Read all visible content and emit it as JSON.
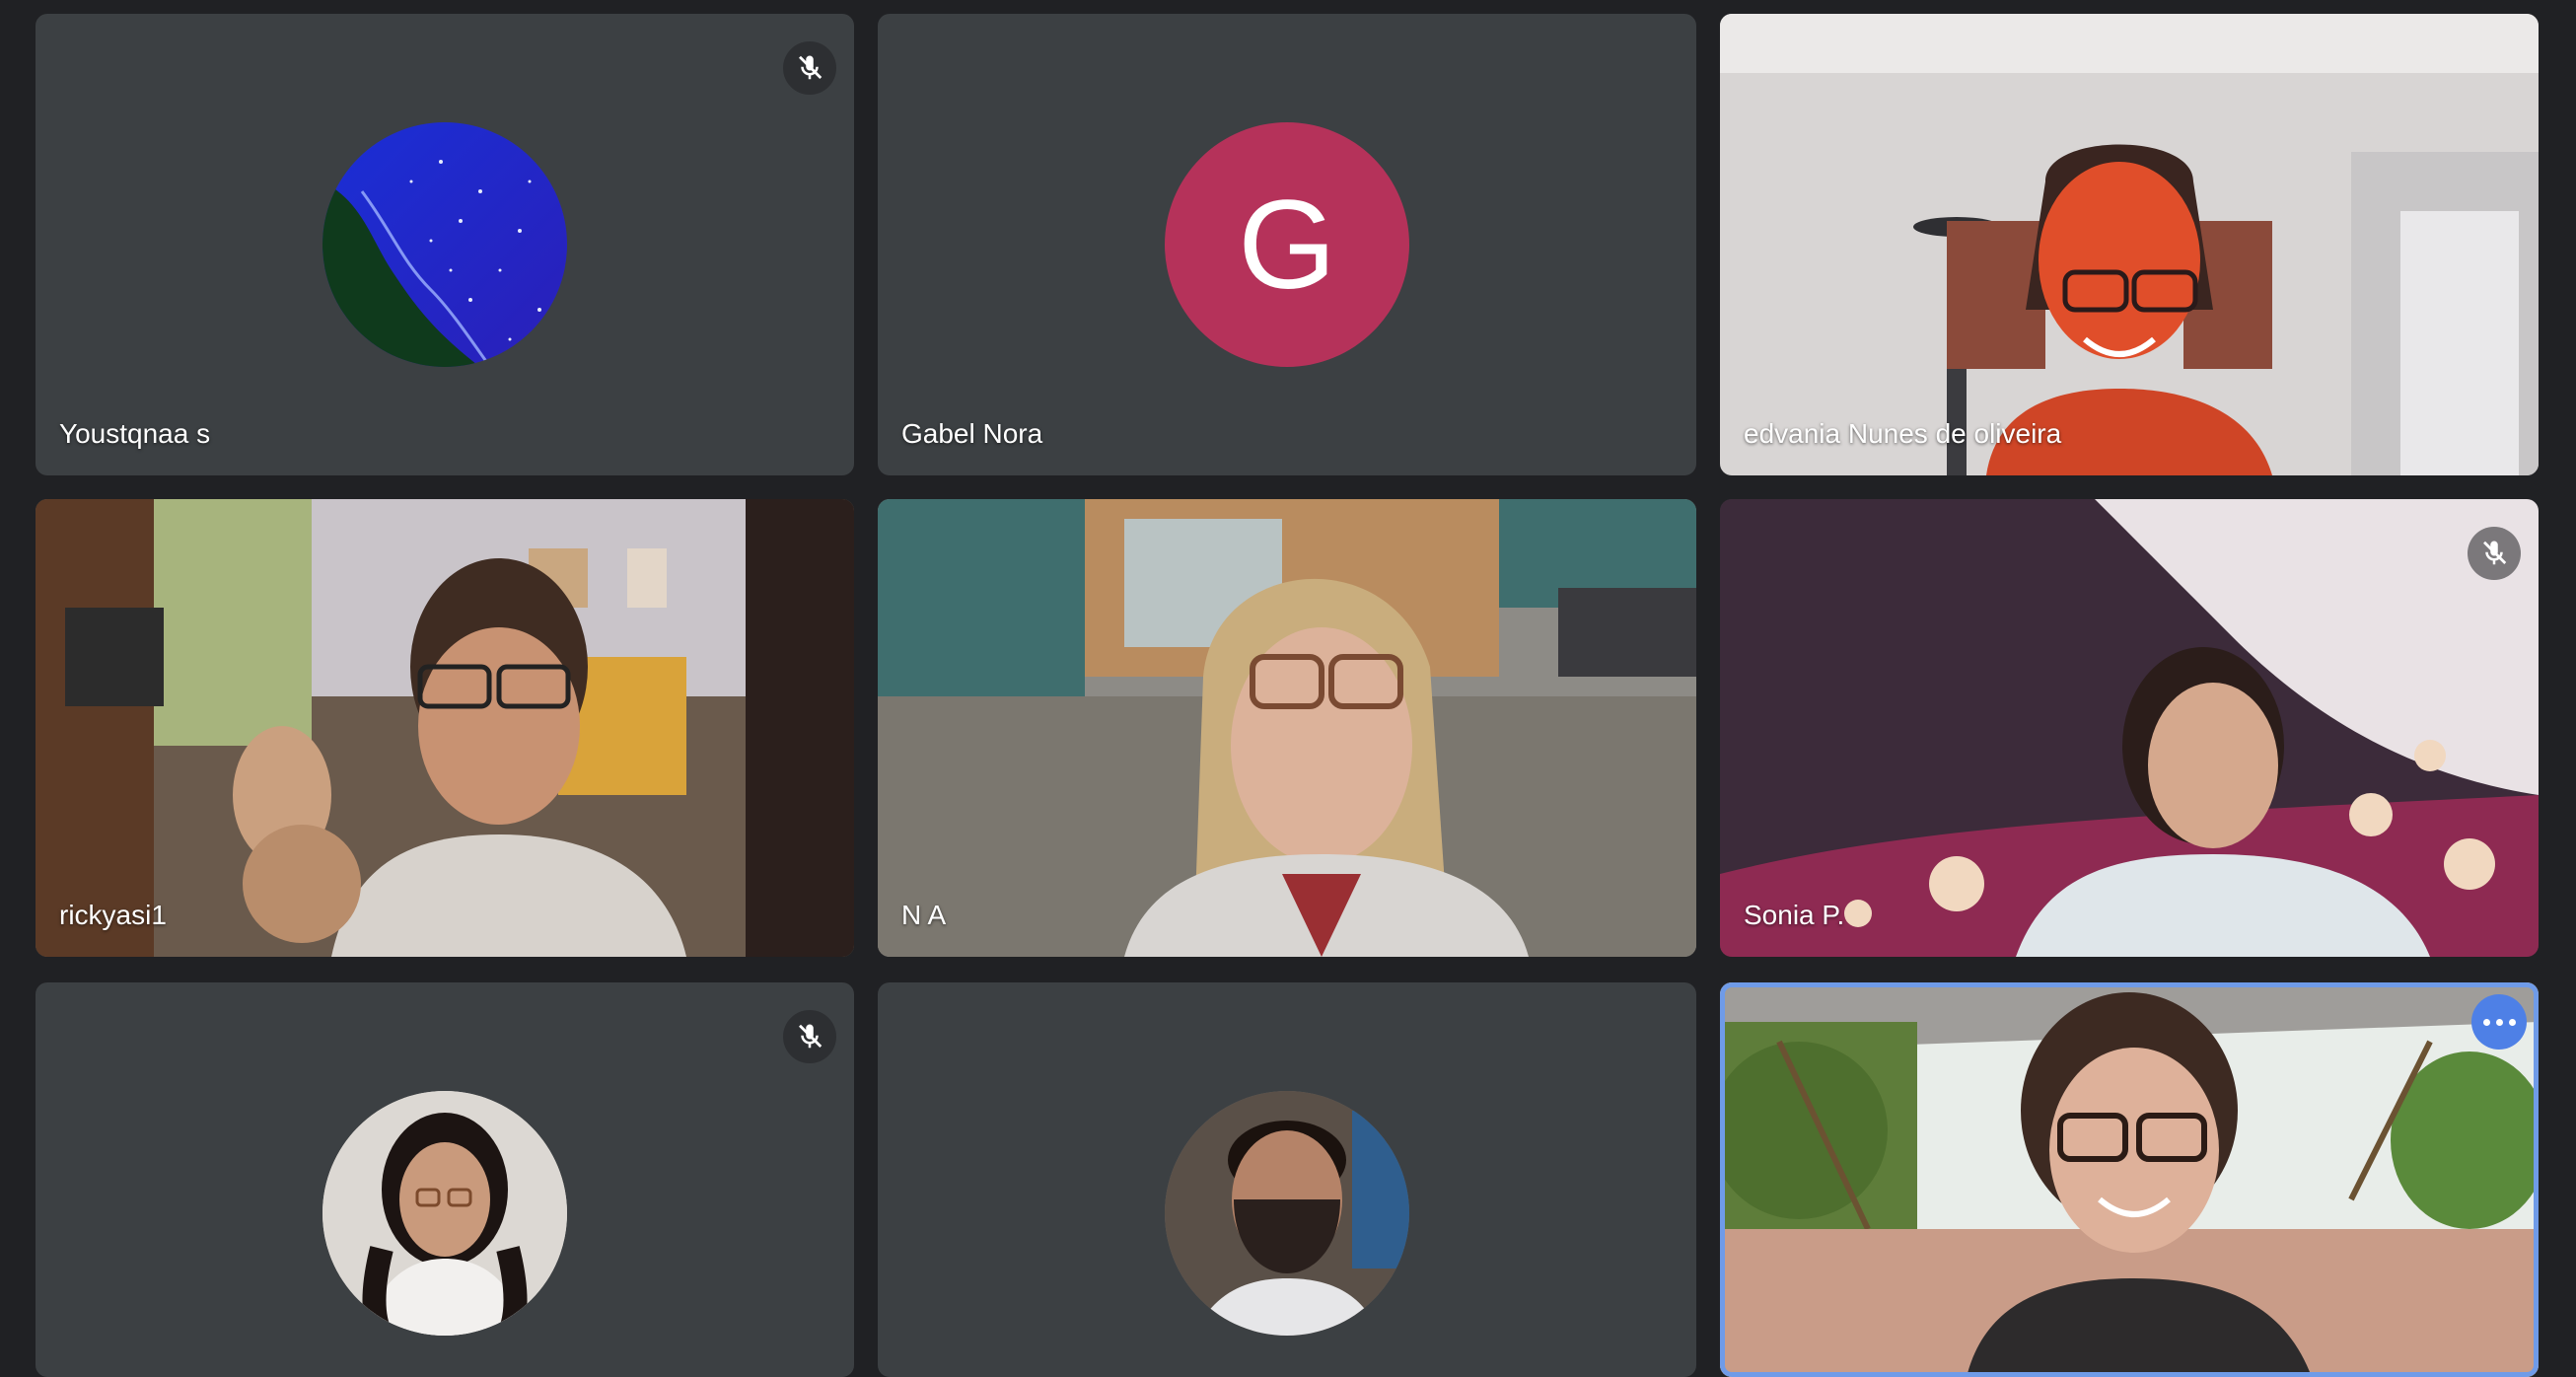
{
  "colors": {
    "background": "#202124",
    "tile": "#3c4043",
    "letter_avatar_gabel": "#b5325a",
    "active_speaker_border": "#6f9be8",
    "more_button": "#4e80e6"
  },
  "participants": [
    {
      "name": "Youstqnaa s",
      "muted": true,
      "avatar": "night-sea-photo-avatar"
    },
    {
      "name": "Gabel Nora",
      "muted": false,
      "avatar_letter": "G"
    },
    {
      "name": "edvania Nunes de oliveira",
      "muted": false,
      "video": true
    },
    {
      "name": "rickyasi1",
      "muted": false,
      "video": true
    },
    {
      "name": "N A",
      "muted": false,
      "video": true
    },
    {
      "name": "Sonia P.",
      "muted": true,
      "video": true
    },
    {
      "name": "",
      "muted": true,
      "avatar": "girl-photo-avatar"
    },
    {
      "name": "",
      "muted": false,
      "avatar": "masked-man-photo-avatar"
    },
    {
      "name": "",
      "muted": false,
      "video": true,
      "active_speaker": true
    }
  ],
  "icons": {
    "mute": "mic-off-icon",
    "more": "more-options-icon"
  }
}
